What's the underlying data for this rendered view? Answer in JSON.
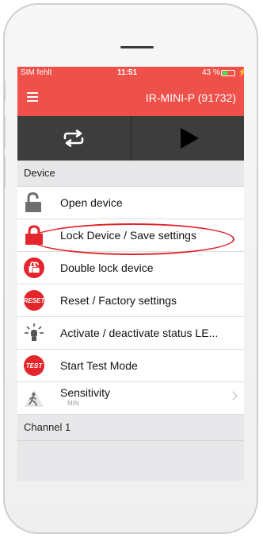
{
  "status_bar": {
    "carrier": "SIM fehlt",
    "time": "11:51",
    "battery": "43 %",
    "battery_level": 0.43
  },
  "navbar": {
    "title": "IR-MINI-P  (91732)"
  },
  "toolbar": {
    "sync_icon": "repeat-icon",
    "play_icon": "play-icon"
  },
  "device_section": {
    "title": "Device"
  },
  "items": [
    {
      "label": "Open device",
      "icon": "unlocked-padlock-icon"
    },
    {
      "label": "Lock Device / Save settings",
      "icon": "locked-padlock-icon"
    },
    {
      "label": "Double lock device",
      "icon": "double-lock-icon"
    },
    {
      "label": "Reset / Factory settings",
      "icon": "reset-badge-icon",
      "badge": "RESET"
    },
    {
      "label": "Activate / deactivate status LE...",
      "icon": "status-led-icon"
    },
    {
      "label": "Start Test Mode",
      "icon": "test-badge-icon",
      "badge": "TEST"
    },
    {
      "label": "Sensitivity",
      "sub": "MIN",
      "icon": "sensitivity-walker-icon"
    }
  ],
  "channel_section": {
    "title": "Channel 1"
  },
  "colors": {
    "accent": "#ee5149",
    "toolbar": "#3d3d3d",
    "icon_red": "#e4262c",
    "icon_gray": "#6e6e6e"
  }
}
